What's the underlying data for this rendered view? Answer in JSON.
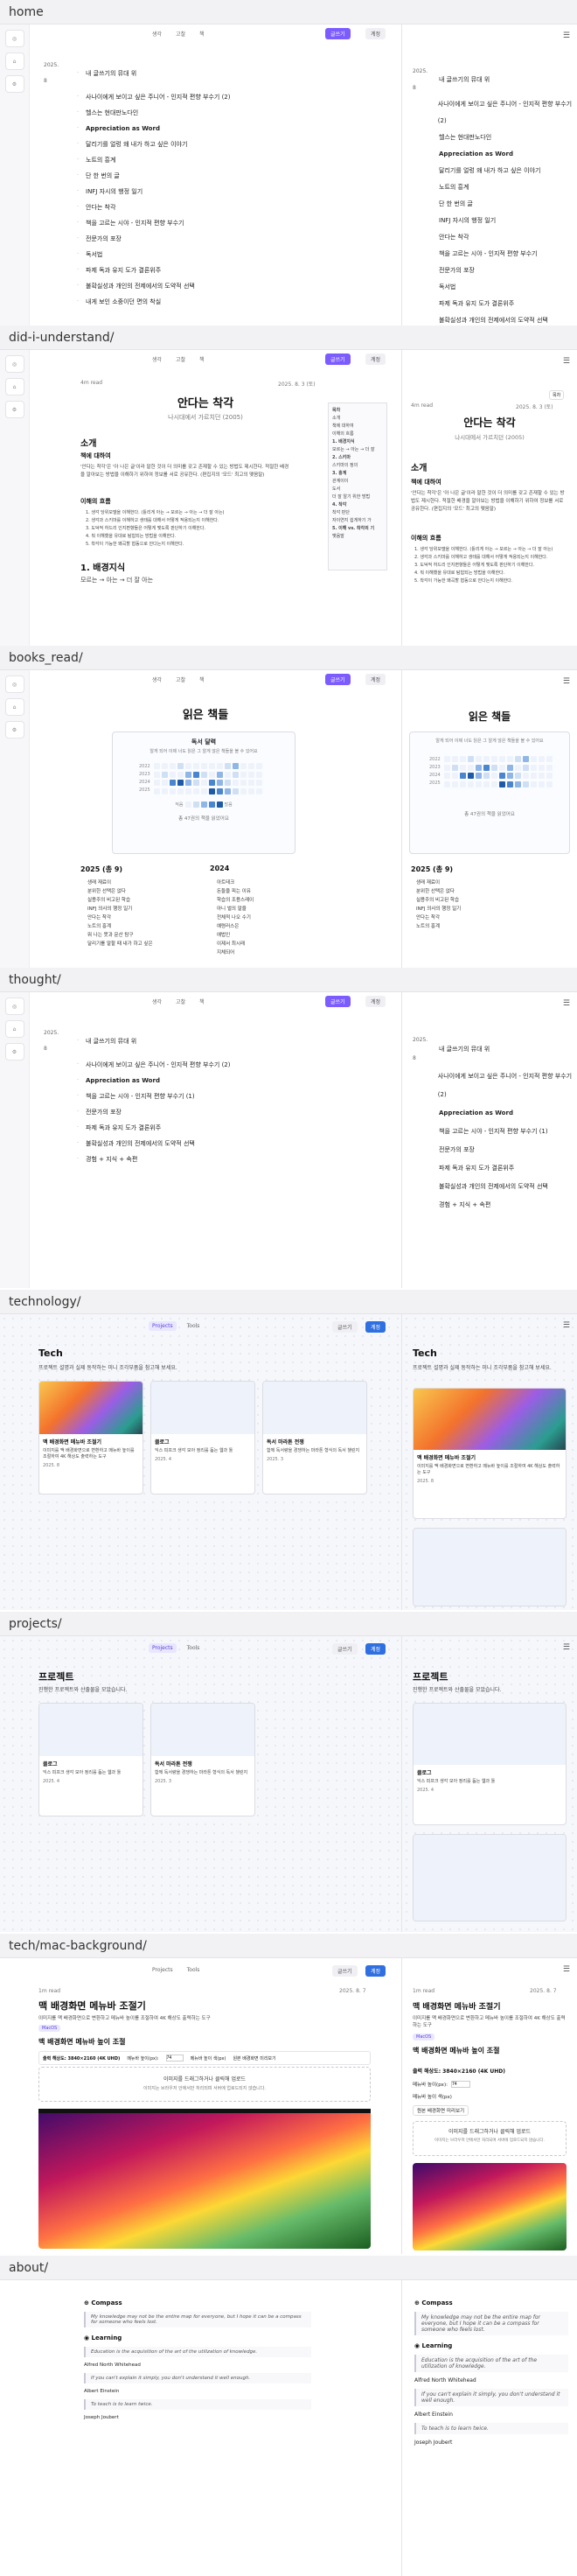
{
  "sections": [
    {
      "label": "home"
    },
    {
      "label": "did-i-understand/"
    },
    {
      "label": "books_read/"
    },
    {
      "label": "thought/"
    },
    {
      "label": "technology/"
    },
    {
      "label": "projects/"
    },
    {
      "label": "tech/mac-background/"
    },
    {
      "label": "about/"
    }
  ],
  "nav": {
    "items": [
      "생각",
      "고찰",
      "책"
    ],
    "primary": "글쓰기",
    "secondary": "계정",
    "projects": "Projects",
    "tools": "Tools"
  },
  "home": {
    "year": "2025. 8",
    "items": [
      "내 글쓰기의 뮤대 위",
      "사나이에게 보이고 싶은 주니어 - 인지적 편향 부수기 (2)",
      "헬스는 현대판노다인",
      "Appreciation as Word",
      "달리기를 얼렁 왜 내가 하고 싶은 이야기",
      "노트의 흥계",
      "단 한 번의 글",
      "INFJ 자시의 행정 일기",
      "안다는 착각",
      "책을 고르는 시야 - 인지적 편향 부수기",
      "전문가의 포장",
      "독서법",
      "파제 독과 유지 도가 결론위주",
      "불확실성과 개인의 전제에서의 도약적 선택",
      "내게 보인 소중이던 면의 착실"
    ]
  },
  "understand": {
    "meta_left": "4m read",
    "meta_right": "2025. 8. 3 (토)",
    "title": "안다는 착각",
    "subtitle": "나시대에서 가르치던 (2005)",
    "h_intro": "소개",
    "h_read": "책에 대하여",
    "intro_p": "'안다는 착각'은 '아 나은 글'이라 말한 것이 더 의미를 갖고 존재할 수 있는 방법도 제시한다. 적절한 배경을 알아보는 방법을 이해하기 위하여 정보를 서로 공유한다. (편집지의 '모드' 최고의 맺음말)",
    "h_points": "이해의 흐름",
    "points": [
      "1. 생각 당위모델을 이해한다. (틀리게 아는 → 모르는 → 아는 → 더 잘 아는)",
      "2. 생각과 스키마를 이해하고 생태를 대해서 어떻게 적용되는지 이해한다.",
      "3. 도덕적 하드리 인지편향들은 어떻게 맺도록 판단하기 이해한다.",
      "4. 뭐 이해했을 유대로 탐험되는 방법을 이해한다.",
      "5. 착각이 가능한 왜곡할 협동으로 안다는지 이해한다."
    ],
    "h_bg": "1. 배경지식",
    "bg_p": "모르는 → 아는 → 더 잘 아는",
    "toc_title": "목차",
    "toc": [
      "소개",
      "책에 대하여",
      "이해의 흐름",
      "1. 배경지식",
      "모르는 → 아는 → 더 잘",
      "2. 스키마",
      "스키마의 정의",
      "3. 흥계",
      "관계이이",
      "도서",
      "더 잘 알기 위한 방법",
      "4. 착각",
      "착각 판단",
      "자이연지 쉽게하기 가",
      "5. 이해 vs. 착각의 기",
      "맺음말"
    ],
    "toc_btn": "목차"
  },
  "books": {
    "title": "읽은 책들",
    "card_title": "독서 달력",
    "card_sub": "알게 되어 이제 너도 읽은 그 알게 않은 책들을 볼 수 있어요",
    "months": [
      "2022",
      "2023",
      "2024",
      "2025"
    ],
    "levels": [
      [
        0,
        0,
        0,
        1,
        0,
        0,
        0,
        0,
        0,
        1,
        2,
        0,
        0,
        0
      ],
      [
        0,
        1,
        0,
        0,
        2,
        3,
        1,
        0,
        2,
        0,
        1,
        0,
        0,
        0
      ],
      [
        0,
        0,
        3,
        4,
        2,
        1,
        0,
        3,
        2,
        1,
        0,
        0,
        0,
        0
      ],
      [
        0,
        0,
        0,
        0,
        0,
        0,
        0,
        4,
        3,
        2,
        1,
        0,
        0,
        0
      ]
    ],
    "legend_less": "적음",
    "legend_more": "많음",
    "total": "총 47권의 책을 읽었어요",
    "year_a": "2025 (총 9)",
    "year_b": "2024",
    "list_a": [
      "생래 재료이",
      "분위한 선택은 없다",
      "실용주의 비고된 학습",
      "INFJ 의사의 행정 일기",
      "안다는 착각",
      "노트의 흥계",
      "뭐 나는 못과 문산 탐구",
      "달리기를 말할 때 내가 하고 싶은"
    ],
    "list_b": [
      "아트테크",
      "돈들을 피는 이유",
      "학습의 조용스레이",
      "아니 벌의 말을",
      "전체적 나오 수기",
      "예령러스은",
      "애법인",
      "이제서 최시래",
      "지체되어"
    ]
  },
  "thought": {
    "year": "2025. 8",
    "items": [
      "내 글쓰기의 뮤대 위",
      "사나이에게 보이고 싶은 주니어 - 인지적 편향 부수기 (2)",
      "Appreciation as Word",
      "책을 고르는 시야 - 인지적 편향 부수기 (1)",
      "전문가의 포장",
      "파제 독과 유지 도가 결론위주",
      "불확실성과 개인의 전제에서의 도약적 선택",
      "경험 + 지식 + 속편"
    ]
  },
  "technology": {
    "title": "Tech",
    "desc": "프로젝트 설명과 실제 동작하는 미니 조각부품을 참고해 보세요.",
    "cards": [
      {
        "title": "맥 배경화면 메뉴바 조절기",
        "desc": "이미지를 맥 배경화면으로 변환하고 메뉴바 높이를 조절하여 4K 해상도 출력하는 도구",
        "date": "2025. 8"
      },
      {
        "title": "클로그",
        "desc": "익스 피프크 생각 모아 정리를 돕는 웹과 툴",
        "date": "2025. 4"
      },
      {
        "title": "독서 마라톤 전쟁",
        "desc": "함께 독서량을 경쟁하는 마라톤 형식의 독서 챌린지",
        "date": "2025. 3"
      }
    ]
  },
  "projects": {
    "title": "프로젝트",
    "desc": "진행한 프로젝트와 산출물을 모았습니다.",
    "cards": [
      {
        "title": "클로그",
        "desc": "익스 피프크 생각 모아 정리를 돕는 웹과 툴",
        "date": "2025. 4"
      },
      {
        "title": "독서 마라톤 전쟁",
        "desc": "함께 독서량을 경쟁하는 마라톤 형식의 독서 챌린지",
        "date": "2025. 3"
      }
    ]
  },
  "mac": {
    "meta_left": "1m read",
    "meta_right": "2025. 8. 7",
    "title": "맥 배경화면 메뉴바 조절기",
    "desc": "이미지를 맥 배경화면으로 변환하고 메뉴바 높이를 조절하여 4K 해상도 출력하는 도구",
    "chip": "MacOS",
    "h2": "맥 배경화면 메뉴바 높이 조절",
    "resolution": "출력 해상도: 3840×2160 (4K UHD)",
    "menubar_label": "메뉴바 높이(px):",
    "menubar_value": "74",
    "menubar_color": "메뉴바 높이 색(px)",
    "preview": "원본 배경화면 미리보기",
    "drop_title": "이미지를 드래그하거나 클릭해 업로드",
    "drop_sub": "이미지는 브라우저 안에서만 처리되며 서버에 업로드되지 않습니다."
  },
  "about": {
    "h1": "Compass",
    "q1": "My knowledge may not be the entire map for everyone, but I hope it can be a compass for someone who feels lost.",
    "h2": "Learning",
    "q2": "Education is the acquisition of the art of the utilization of knowledge.",
    "a2": "Alfred North Whitehead",
    "q3": "If you can't explain it simply, you don't understand it well enough.",
    "a3": "Albert Einstein",
    "q4": "To teach is to learn twice.",
    "a4": "Joseph Joubert"
  },
  "colors": {
    "accent": "#7c5cff",
    "blue": "#2f6fe0",
    "heat": [
      "#eef3fb",
      "#cfe0f5",
      "#8fb6e6",
      "#4a86cf",
      "#1f5aa8"
    ]
  }
}
